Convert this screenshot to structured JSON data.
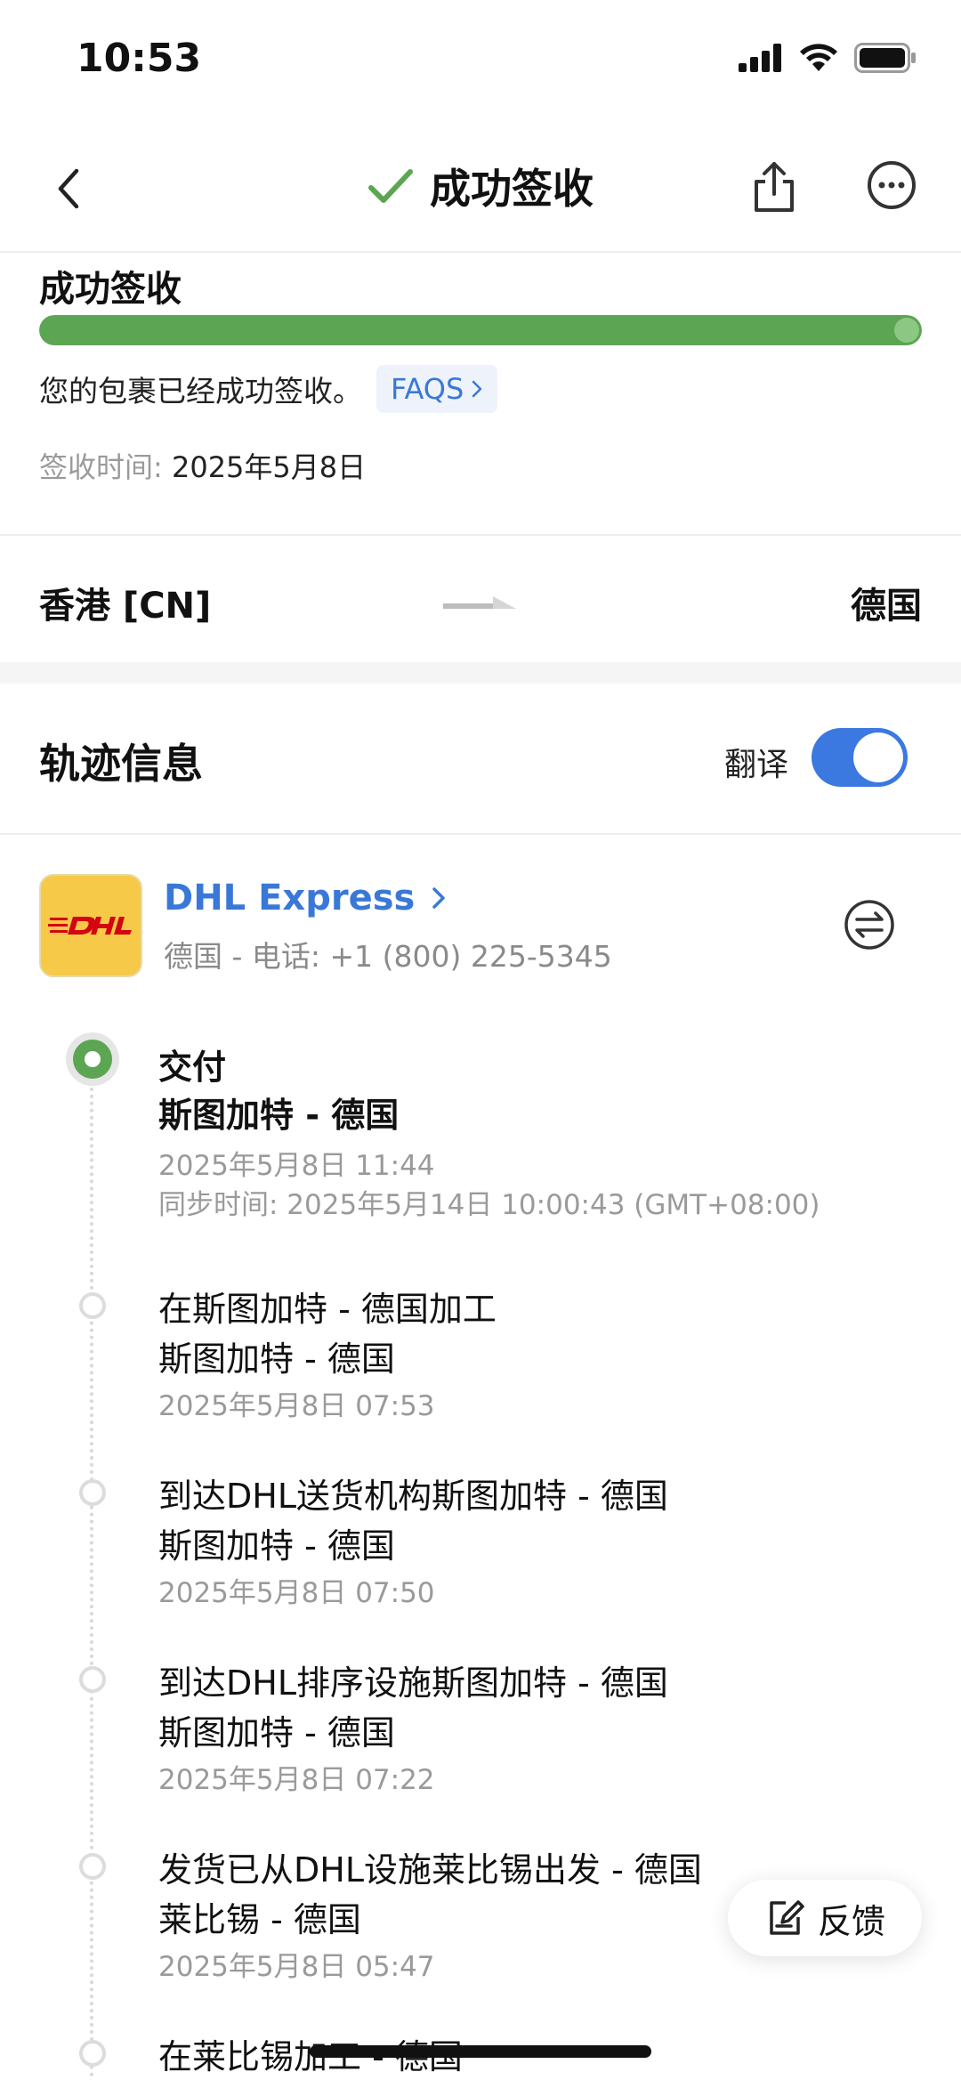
{
  "status_bar": {
    "time": "10:53"
  },
  "nav": {
    "title": "成功签收",
    "title_color": "#5ca552"
  },
  "status": {
    "heading": "成功签收",
    "progress": 1.0,
    "description": "您的包裹已经成功签收。",
    "faqs_label": "FAQS",
    "sign_label": "签收时间: ",
    "sign_value": "2025年5月8日"
  },
  "route": {
    "from": "香港 [CN]",
    "to": "德国"
  },
  "tracking": {
    "title": "轨迹信息",
    "translate_label": "翻译",
    "translate_on": true
  },
  "carrier": {
    "name": "DHL Express",
    "contact": "德国 - 电话: +1 (800) 225-5345",
    "brand_color": "#f7c948",
    "logo_text_color": "#d40511"
  },
  "events": [
    {
      "title": "交付",
      "location": "斯图加特 - 德国",
      "time": "2025年5月8日 11:44",
      "sync": "同步时间: 2025年5月14日 10:00:43 (GMT+08:00)",
      "active": true
    },
    {
      "title": "在斯图加特 - 德国加工",
      "location": "斯图加特 - 德国",
      "time": "2025年5月8日 07:53"
    },
    {
      "title": "到达DHL送货机构斯图加特 - 德国",
      "location": "斯图加特 - 德国",
      "time": "2025年5月8日 07:50"
    },
    {
      "title": "到达DHL排序设施斯图加特 - 德国",
      "location": "斯图加特 - 德国",
      "time": "2025年5月8日 07:22"
    },
    {
      "title": "发货已从DHL设施莱比锡出发 - 德国",
      "location": "莱比锡 - 德国",
      "time": "2025年5月8日 05:47"
    },
    {
      "title": "在莱比锡加工 - 德国"
    }
  ],
  "feedback": {
    "label": "反馈"
  }
}
